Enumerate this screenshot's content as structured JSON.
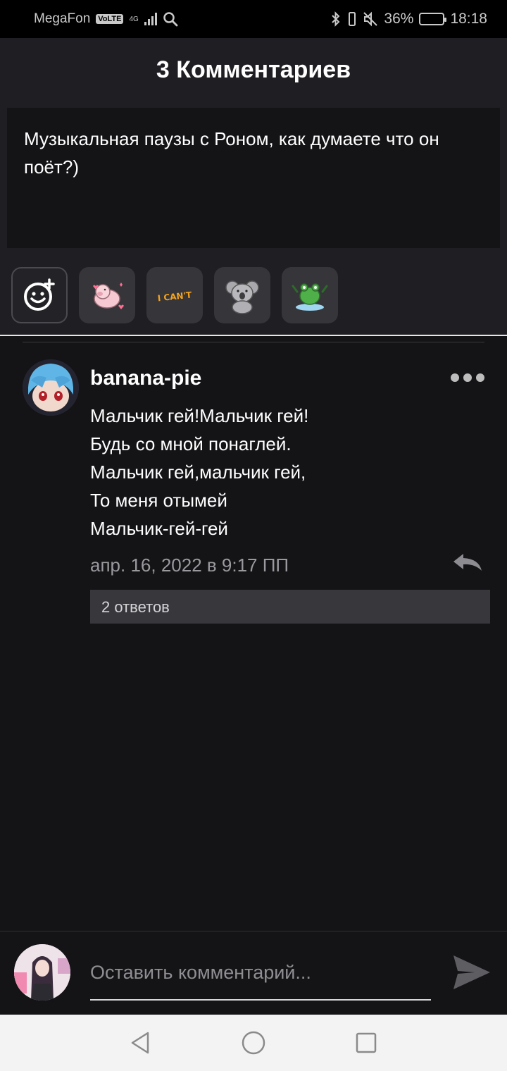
{
  "status_bar": {
    "carrier": "MegaFon",
    "volte": "VoLTE",
    "network": "4G",
    "battery_percent": "36%",
    "battery_level": 0.36,
    "time": "18:18"
  },
  "header": {
    "title": "3 Комментариев"
  },
  "post": {
    "text": "Музыкальная паузы с Роном, как думаете что он поёт?)"
  },
  "stickers": [
    {
      "icon": "emoji-add-icon"
    },
    {
      "icon": "pig-sticker"
    },
    {
      "icon": "i-cant-sticker",
      "text": "I CAN'T"
    },
    {
      "icon": "koala-sticker"
    },
    {
      "icon": "frog-sticker"
    }
  ],
  "comment": {
    "username": "banana-pie",
    "lines": [
      "Мальчик гей!Мальчик гей!",
      "Будь со мной понаглей.",
      "Мальчик гей,мальчик гей,",
      "То меня отымей",
      "Мальчик-гей-гей"
    ],
    "timestamp": "апр. 16, 2022 в 9:17 ПП",
    "replies_label": "2 ответов"
  },
  "input": {
    "placeholder": "Оставить комментарий..."
  },
  "colors": {
    "background": "#141316",
    "panel": "#1f1e22",
    "muted_text": "#9a999e"
  }
}
